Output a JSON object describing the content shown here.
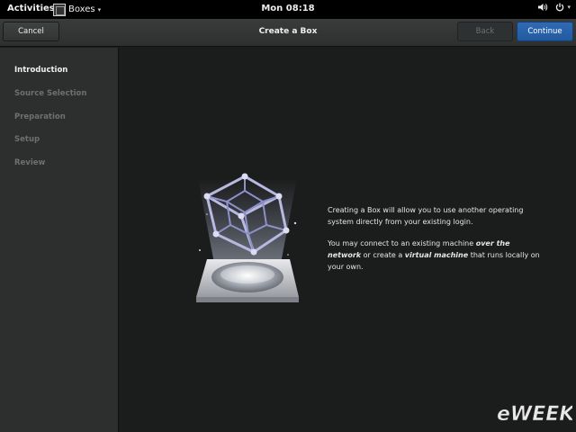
{
  "top_panel": {
    "activities": "Activities",
    "app_menu": "Boxes",
    "app_menu_arrow": "▾",
    "clock": "Mon 08:18",
    "volume_icon": "volume-icon",
    "power_icon": "power-icon",
    "power_arrow": "▾"
  },
  "header": {
    "cancel": "Cancel",
    "title": "Create a Box",
    "back": "Back",
    "continue": "Continue"
  },
  "sidebar": {
    "items": [
      {
        "label": "Introduction",
        "active": true
      },
      {
        "label": "Source Selection",
        "active": false
      },
      {
        "label": "Preparation",
        "active": false
      },
      {
        "label": "Setup",
        "active": false
      },
      {
        "label": "Review",
        "active": false
      }
    ]
  },
  "intro": {
    "p1": "Creating a Box will allow you to use another operating system directly from your existing login.",
    "p2_a": "You may connect to an existing machine ",
    "p2_b": "over the network",
    "p2_c": " or create a ",
    "p2_d": "virtual machine",
    "p2_e": " that runs locally on your own."
  },
  "watermark": "eWEEK",
  "colors": {
    "accent": "#2a64ad",
    "panel": "#000000",
    "sidebar": "#2d2f2f",
    "main_bg": "#1b1c1c"
  }
}
